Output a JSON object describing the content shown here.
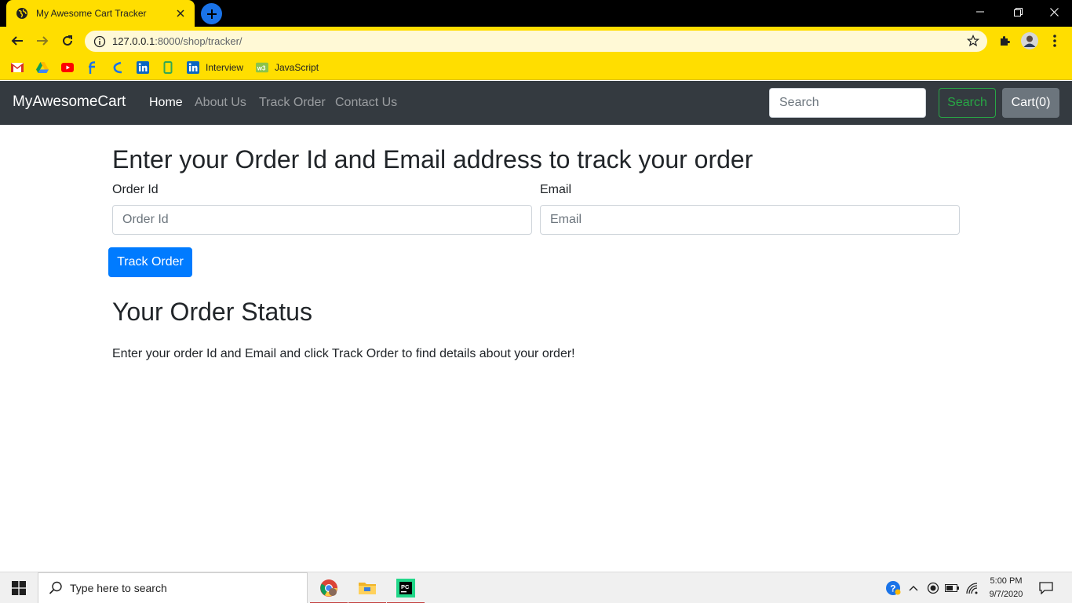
{
  "browser": {
    "tab_title": "My Awesome Cart Tracker",
    "url_host": "127.0.0.1",
    "url_rest": ":8000/shop/tracker/",
    "bookmarks": [
      {
        "icon": "gmail-icon",
        "label": ""
      },
      {
        "icon": "drive-icon",
        "label": ""
      },
      {
        "icon": "youtube-icon",
        "label": ""
      },
      {
        "icon": "bookmark-f-icon",
        "label": ""
      },
      {
        "icon": "bookmark-c-icon",
        "label": ""
      },
      {
        "icon": "linkedin-icon",
        "label": ""
      },
      {
        "icon": "bookmark-green-icon",
        "label": ""
      },
      {
        "icon": "linkedin-icon",
        "label": "Interview"
      },
      {
        "icon": "w3schools-icon",
        "label": "JavaScript"
      }
    ],
    "accent": "#ffde00"
  },
  "site": {
    "brand": "MyAwesomeCart",
    "nav": [
      "Home",
      "About Us",
      "Track Order",
      "Contact Us"
    ],
    "search_placeholder": "Search",
    "search_button": "Search",
    "cart_button": "Cart(0)",
    "navbar_color": "#343a40"
  },
  "tracker": {
    "heading": "Enter your Order Id and Email address to track your order",
    "order_id_label": "Order Id",
    "order_id_placeholder": "Order Id",
    "order_id_value": "",
    "email_label": "Email",
    "email_placeholder": "Email",
    "email_value": "",
    "submit_label": "Track Order",
    "primary_color": "#007bff"
  },
  "status": {
    "heading": "Your Order Status",
    "message": "Enter your order Id and Email and click Track Order to find details about your order!"
  },
  "taskbar": {
    "search_placeholder": "Type here to search",
    "apps": [
      "chrome-icon",
      "file-explorer-icon",
      "pycharm-icon"
    ],
    "time": "5:00 PM",
    "date": "9/7/2020"
  }
}
